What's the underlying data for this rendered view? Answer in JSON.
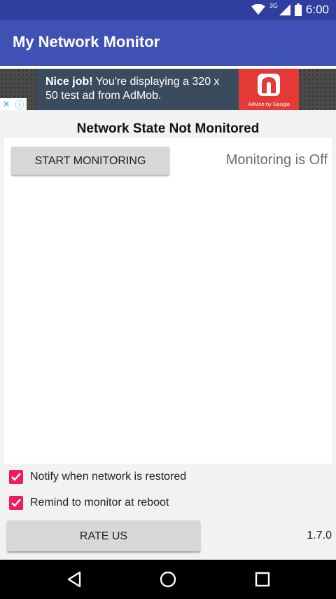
{
  "status_bar": {
    "time": "6:00",
    "network": "3G",
    "icons": [
      "wifi-icon",
      "cellular-signal-icon",
      "battery-icon"
    ]
  },
  "app_bar": {
    "title": "My Network Monitor"
  },
  "ad": {
    "headline_bold": "Nice job!",
    "headline_rest": " You're displaying a 320 x 50 test ad from AdMob.",
    "brand_caption": "AdMob by Google",
    "close_glyph": "✕",
    "info_glyph": "ⓘ"
  },
  "main": {
    "state_title": "Network State Not Monitored",
    "start_button_label": "START MONITORING",
    "monitoring_status": "Monitoring is Off",
    "checkboxes": [
      {
        "label": "Notify when network is restored",
        "checked": true
      },
      {
        "label": "Remind to monitor at reboot",
        "checked": true
      }
    ],
    "rate_button_label": "RATE US",
    "version": "1.7.0"
  },
  "nav_bar": {
    "buttons": [
      "back-icon",
      "home-icon",
      "recents-icon"
    ]
  },
  "colors": {
    "primary": "#3f51b5",
    "primary_dark": "#303f9f",
    "accent": "#e91e63"
  }
}
